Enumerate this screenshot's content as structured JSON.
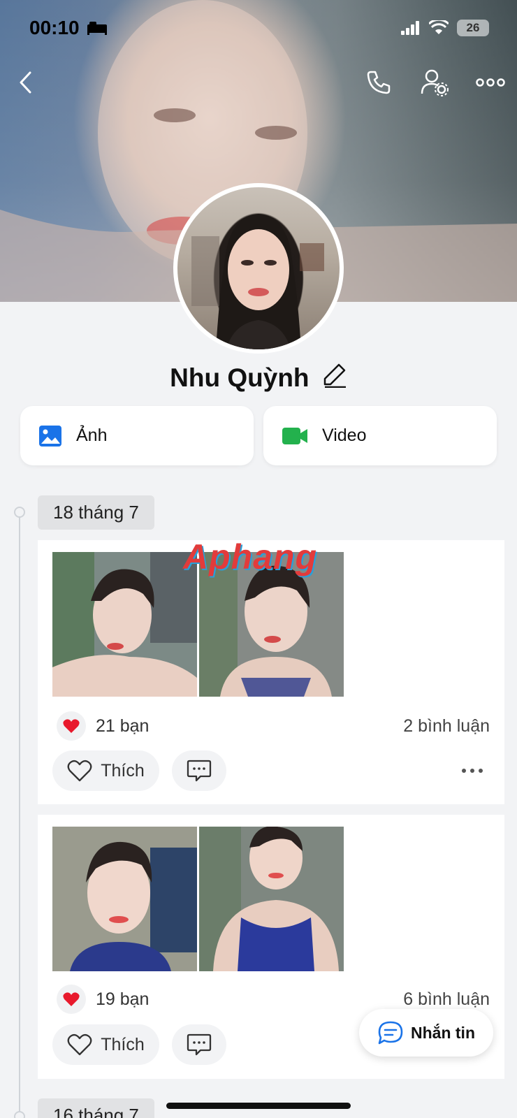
{
  "status_bar": {
    "time": "00:10",
    "battery": "26"
  },
  "profile": {
    "name": "Nhu Quỳnh"
  },
  "media_tabs": {
    "photos_label": "Ảnh",
    "video_label": "Video"
  },
  "watermark": "Aphang",
  "timeline": [
    {
      "date": "18 tháng 7",
      "reactions": "21 bạn",
      "comments": "2 bình luận",
      "like_label": "Thích"
    },
    {
      "reactions": "19 bạn",
      "comments": "6 bình luận",
      "like_label": "Thích"
    },
    {
      "date": "16 tháng 7"
    }
  ],
  "fab": {
    "label": "Nhắn tin"
  },
  "colors": {
    "accent": "#1a73e8",
    "video_green": "#23b14d",
    "heart": "#e8192c"
  },
  "icons": [
    "back-icon",
    "phone-icon",
    "user-settings-icon",
    "more-icon",
    "edit-icon",
    "image-icon",
    "video-icon",
    "heart-icon",
    "comment-icon",
    "message-icon"
  ]
}
